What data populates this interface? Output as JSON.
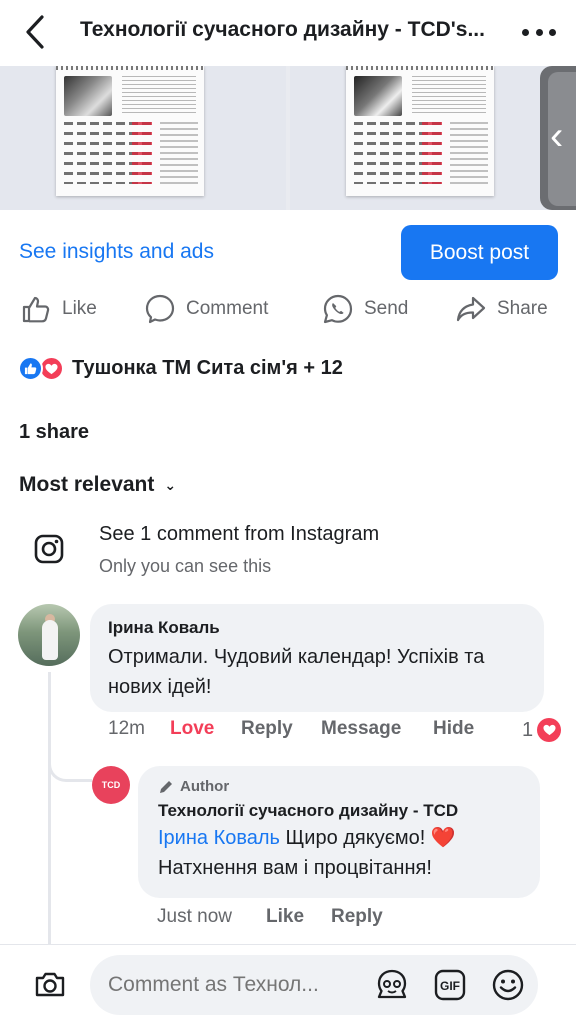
{
  "header": {
    "title": "Технології сучасного дизайну - TCD's..."
  },
  "post": {
    "insights_link": "See insights and ads",
    "boost_label": "Boost post"
  },
  "actions": {
    "like": "Like",
    "comment": "Comment",
    "send": "Send",
    "share": "Share"
  },
  "reactions": {
    "names": "Тушонка ТМ Сита сім'я + 12"
  },
  "shares": "1 share",
  "sort": {
    "label": "Most relevant"
  },
  "instagram": {
    "title": "See 1 comment from Instagram",
    "subtitle": "Only you can see this"
  },
  "comments": [
    {
      "author": "Ірина Коваль",
      "text": "Отримали. Чудовий календар! Успіхів та нових ідей!",
      "time": "12m",
      "love": "Love",
      "reply": "Reply",
      "message": "Message",
      "hide": "Hide",
      "reaction_count": "1"
    }
  ],
  "reply": {
    "badge": "Author",
    "author": "Технології сучасного дизайну - TCD",
    "mention": "Ірина Коваль",
    "text": " Щиро дякуємо! ❤️ Натхнення вам і процвітання!",
    "time": "Just now",
    "like": "Like",
    "reply": "Reply",
    "avatar_text": "TCD"
  },
  "composer": {
    "placeholder": "Comment as Технол..."
  },
  "colors": {
    "accent": "#1877f2",
    "love": "#f33e58",
    "brand": "#e8425c"
  }
}
